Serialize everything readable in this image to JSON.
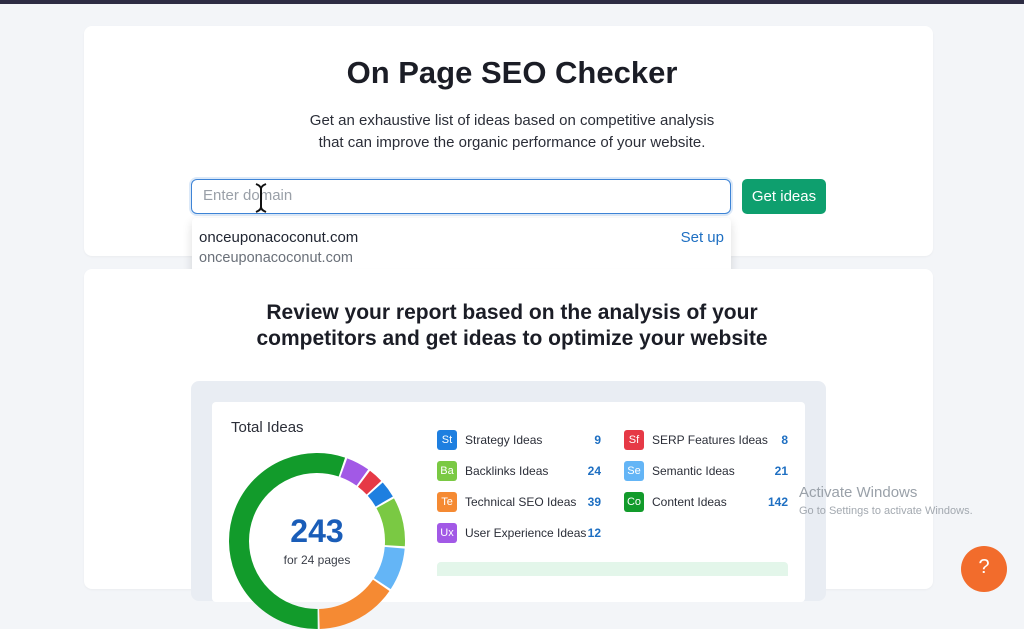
{
  "header": {
    "title": "On Page SEO Checker",
    "subtitle_line1": "Get an exhaustive list of ideas based on competitive analysis",
    "subtitle_line2": "that can improve the organic performance of your website."
  },
  "search": {
    "placeholder": "Enter domain",
    "button_label": "Get ideas"
  },
  "suggestions": [
    {
      "domain": "onceuponacoconut.com",
      "subtext": "onceuponacoconut.com",
      "action": "Set up"
    }
  ],
  "report": {
    "heading_line1": "Review your report based on the analysis of your",
    "heading_line2": "competitors and get ideas to optimize your website"
  },
  "total_ideas": {
    "label": "Total Ideas",
    "count": "243",
    "pages": "for 24 pages"
  },
  "categories": [
    {
      "abbr": "St",
      "label": "Strategy Ideas",
      "count": "9",
      "color": "#1e7fe0"
    },
    {
      "abbr": "Ba",
      "label": "Backlinks Ideas",
      "count": "24",
      "color": "#7ac943"
    },
    {
      "abbr": "Te",
      "label": "Technical SEO Ideas",
      "count": "39",
      "color": "#f58a33"
    },
    {
      "abbr": "Ux",
      "label": "User Experience Ideas",
      "count": "12",
      "color": "#a259e6"
    },
    {
      "abbr": "Sf",
      "label": "SERP Features Ideas",
      "count": "8",
      "color": "#e63946"
    },
    {
      "abbr": "Se",
      "label": "Semantic Ideas",
      "count": "21",
      "color": "#64b5f6"
    },
    {
      "abbr": "Co",
      "label": "Content Ideas",
      "count": "142",
      "color": "#129b2b"
    }
  ],
  "donut_segments": [
    {
      "name": "Content Ideas",
      "value": 142,
      "color": "#129b2b"
    },
    {
      "name": "User Experience Ideas",
      "value": 12,
      "color": "#a259e6"
    },
    {
      "name": "SERP Features Ideas",
      "value": 8,
      "color": "#e63946"
    },
    {
      "name": "Strategy Ideas",
      "value": 9,
      "color": "#1e7fe0"
    },
    {
      "name": "Backlinks Ideas",
      "value": 24,
      "color": "#7ac943"
    },
    {
      "name": "Semantic Ideas",
      "value": 21,
      "color": "#64b5f6"
    },
    {
      "name": "Technical SEO Ideas",
      "value": 39,
      "color": "#f58a33"
    }
  ],
  "watermark": {
    "line1": "Activate Windows",
    "line2": "Go to Settings to activate Windows."
  },
  "help": {
    "label": "?"
  }
}
